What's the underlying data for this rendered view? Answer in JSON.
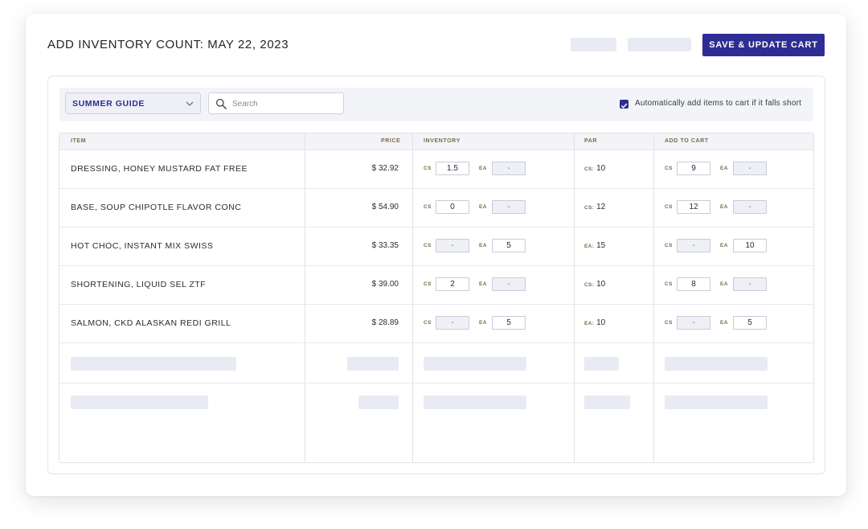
{
  "header": {
    "title": "ADD INVENTORY COUNT: MAY 22, 2023",
    "save_button": "SAVE & UPDATE CART"
  },
  "toolbar": {
    "guide": "SUMMER GUIDE",
    "search_placeholder": "Search",
    "auto_add_label": "Automatically add items to cart if it falls short",
    "auto_add_checked": true
  },
  "table": {
    "columns": {
      "item": "ITEM",
      "price": "PRICE",
      "inventory": "INVENTORY",
      "par": "PAR",
      "add_to_cart": "ADD TO CART"
    },
    "unit_labels": {
      "cs": "CS",
      "ea": "EA"
    },
    "rows": [
      {
        "item": "DRESSING, HONEY MUSTARD FAT FREE",
        "price": "$ 32.92",
        "inv_cs": "1.5",
        "inv_ea": "-",
        "par_unit": "CS:",
        "par_value": "10",
        "cart_cs": "9",
        "cart_ea": "-"
      },
      {
        "item": "BASE, SOUP CHIPOTLE FLAVOR CONC",
        "price": "$ 54.90",
        "inv_cs": "0",
        "inv_ea": "-",
        "par_unit": "CS:",
        "par_value": "12",
        "cart_cs": "12",
        "cart_ea": "-"
      },
      {
        "item": "HOT CHOC, INSTANT MIX SWISS",
        "price": "$ 33.35",
        "inv_cs": "-",
        "inv_ea": "5",
        "par_unit": "EA:",
        "par_value": "15",
        "cart_cs": "-",
        "cart_ea": "10"
      },
      {
        "item": "SHORTENING, LIQUID SEL ZTF",
        "price": "$ 39.00",
        "inv_cs": "2",
        "inv_ea": "-",
        "par_unit": "CS:",
        "par_value": "10",
        "cart_cs": "8",
        "cart_ea": "-"
      },
      {
        "item": "SALMON, CKD ALASKAN REDI GRILL",
        "price": "$ 28.89",
        "inv_cs": "-",
        "inv_ea": "5",
        "par_unit": "EA:",
        "par_value": "10",
        "cart_cs": "-",
        "cart_ea": "5"
      }
    ]
  },
  "colors": {
    "accent": "#2e2d94",
    "placeholder": "#e8ebf3",
    "column_header_text": "#7a6a4a"
  }
}
